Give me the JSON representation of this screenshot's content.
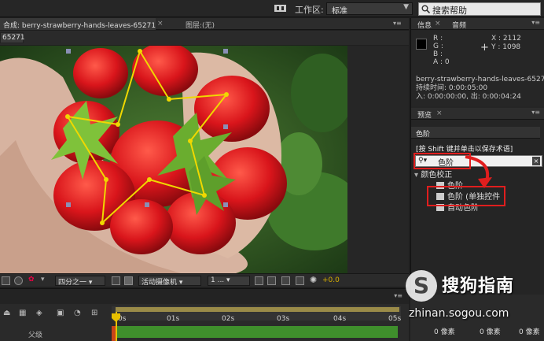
{
  "topbar": {
    "workspace_label": "工作区:",
    "workspace_value": "标准",
    "search_placeholder": "搜索帮助"
  },
  "composition": {
    "tab_label": "合成: berry-strawberry-hands-leaves-65271",
    "layer_tab": "图层:(无)",
    "sub_tab": "65271"
  },
  "viewer_controls": {
    "resolution": "四分之一",
    "camera": "活动摄像机",
    "views": "1 ...",
    "exposure": "+0.0"
  },
  "timeline": {
    "ticks": [
      "0s",
      "01s",
      "02s",
      "03s",
      "04s",
      "05s"
    ],
    "parent_label": "父级"
  },
  "info_panel": {
    "tabs": [
      "信息",
      "音频"
    ],
    "rgba": [
      "R :",
      "G :",
      "B :",
      "A : 0"
    ],
    "x": "X : 2112",
    "y": "Y : 1098",
    "file_name": "berry-strawberry-hands-leaves-65271.j",
    "duration": "持续时间: 0:00:05:00",
    "in_out": "入: 0:00:00:00, 出: 0:00:04:24"
  },
  "effects_panel": {
    "tab": "预览",
    "preset_title": "色阶",
    "hint": "[按 Shift 键并单击以保存术语]",
    "search_value": "色阶",
    "category": "颜色校正",
    "items": [
      "色阶",
      "色阶 (单独控件"
    ],
    "extra_item": "自动色阶"
  },
  "bottom_panel": {
    "px1": "0 像素",
    "px2": "0 像素",
    "px3": "0 像素"
  },
  "watermark": {
    "logo_letter": "S",
    "brand": "搜狗指南",
    "url": "zhinan.sogou.com"
  },
  "colors": {
    "highlight_red": "#e01e1e",
    "mask_yellow": "#f0d800",
    "timeline_green": "#3f8f2c"
  }
}
